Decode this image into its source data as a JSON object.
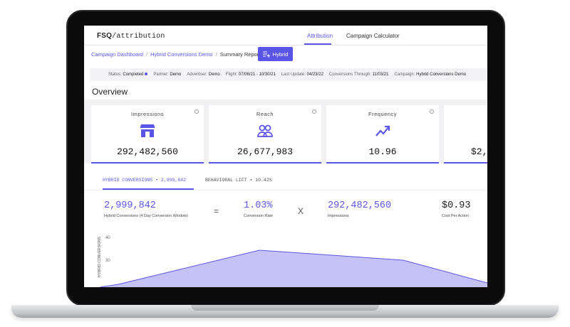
{
  "nav": {
    "brand_prefix": "FSQ",
    "brand_suffix": "/attribution",
    "tabs": [
      {
        "label": "Attribution",
        "active": true
      },
      {
        "label": "Campaign Calculator",
        "active": false
      }
    ]
  },
  "breadcrumb": {
    "items": [
      "Campaign Dashboard",
      "Hybrid Conversions Demo",
      "Summary Report"
    ],
    "separator": "/"
  },
  "hybrid_button": {
    "label": "Hybrid",
    "icon": "add-list-icon"
  },
  "status": [
    {
      "key": "Status:",
      "value": "Completed"
    },
    {
      "key": "Partner:",
      "value": "Demo"
    },
    {
      "key": "Advertiser:",
      "value": "Demo"
    },
    {
      "key": "Flight:",
      "value": "07/06/21 - 10/30/21"
    },
    {
      "key": "Last Update:",
      "value": "04/23/22"
    },
    {
      "key": "Conversions Through:",
      "value": "11/03/21"
    },
    {
      "key": "Campaign:",
      "value": "Hybrid Conversions Demo"
    }
  ],
  "overview_title": "Overview",
  "cards": [
    {
      "title": "Impressions",
      "value": "292,482,560",
      "icon": "storefront-icon"
    },
    {
      "title": "Reach",
      "value": "26,677,983",
      "icon": "people-icon"
    },
    {
      "title": "Frequency",
      "value": "10.96",
      "icon": "trend-line-icon"
    },
    {
      "title": "",
      "value": "$2,",
      "icon": ""
    }
  ],
  "subtabs": [
    {
      "label": "HYBRID CONVERSIONS • 2,999,842",
      "active": true
    },
    {
      "label": "BEHAVIORAL LIFT • 10.42%",
      "active": false
    }
  ],
  "metrics": [
    {
      "value": "2,999,842",
      "label": "Hybrid Conversions (4 Day Conversion Window)"
    },
    {
      "value": "1.03%",
      "label": "Conversion Rate"
    },
    {
      "value": "292,482,560",
      "label": "Impressions"
    },
    {
      "value": "$0.93",
      "label": "Cost Per Action"
    }
  ],
  "operators": [
    "=",
    "X"
  ],
  "chart": {
    "y_ticks": [
      "40",
      "30"
    ],
    "y_axis_title": "HYBRID CONVERSIONS",
    "accent": "#5b54e8",
    "fill": "#c5c2f7"
  },
  "colors": {
    "accent": "#5b54e8"
  }
}
